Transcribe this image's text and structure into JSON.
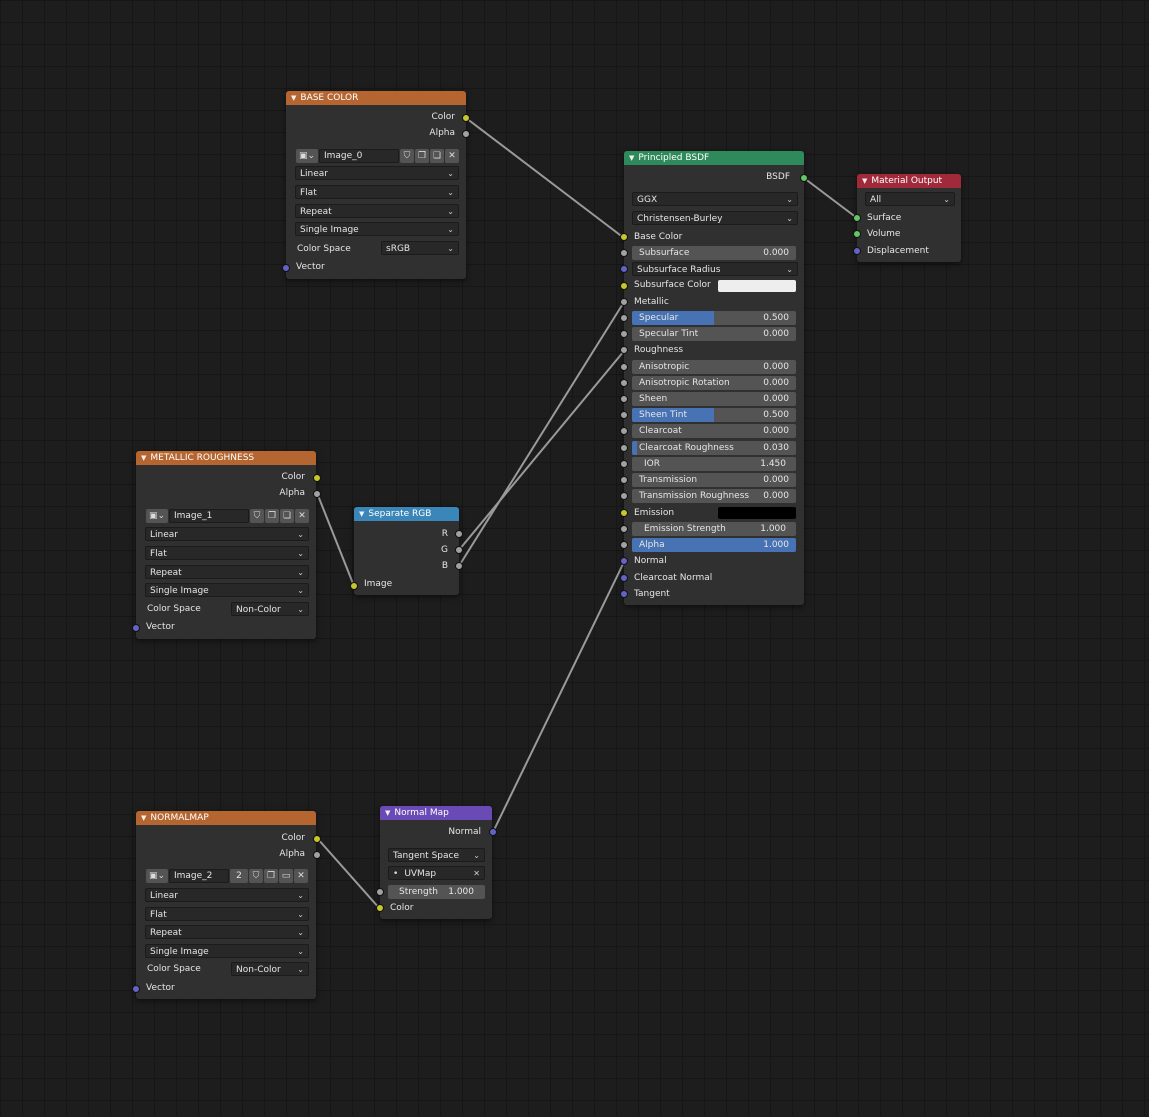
{
  "nodes": {
    "base_color": {
      "title": "BASE COLOR",
      "outputs": [
        "Color",
        "Alpha"
      ],
      "image_name": "Image_0",
      "interpolation": "Linear",
      "projection": "Flat",
      "extension": "Repeat",
      "source": "Single Image",
      "color_space_label": "Color Space",
      "color_space": "sRGB",
      "vector": "Vector"
    },
    "metallic_roughness": {
      "title": "METALLIC ROUGHNESS",
      "outputs": [
        "Color",
        "Alpha"
      ],
      "image_name": "Image_1",
      "interpolation": "Linear",
      "projection": "Flat",
      "extension": "Repeat",
      "source": "Single Image",
      "color_space_label": "Color Space",
      "color_space": "Non-Color",
      "vector": "Vector"
    },
    "normalmap": {
      "title": "NORMALMAP",
      "outputs": [
        "Color",
        "Alpha"
      ],
      "image_name": "Image_2",
      "user_count": "2",
      "interpolation": "Linear",
      "projection": "Flat",
      "extension": "Repeat",
      "source": "Single Image",
      "color_space_label": "Color Space",
      "color_space": "Non-Color",
      "vector": "Vector"
    },
    "separate_rgb": {
      "title": "Separate RGB",
      "outputs": [
        "R",
        "G",
        "B"
      ],
      "input": "Image"
    },
    "normal_map": {
      "title": "Normal Map",
      "output": "Normal",
      "space": "Tangent Space",
      "uv_map": "UVMap",
      "strength_label": "Strength",
      "strength_value": "1.000",
      "input": "Color"
    },
    "principled": {
      "title": "Principled BSDF",
      "output": "BSDF",
      "distribution": "GGX",
      "subsurface_method": "Christensen-Burley",
      "base_color": "Base Color",
      "subsurface": {
        "label": "Subsurface",
        "value": "0.000",
        "fill": 0
      },
      "subsurface_radius": "Subsurface Radius",
      "subsurface_color": "Subsurface Color",
      "metallic": "Metallic",
      "specular": {
        "label": "Specular",
        "value": "0.500",
        "fill": 0.5
      },
      "specular_tint": {
        "label": "Specular Tint",
        "value": "0.000",
        "fill": 0
      },
      "roughness": "Roughness",
      "anisotropic": {
        "label": "Anisotropic",
        "value": "0.000",
        "fill": 0
      },
      "anisotropic_rotation": {
        "label": "Anisotropic Rotation",
        "value": "0.000",
        "fill": 0
      },
      "sheen": {
        "label": "Sheen",
        "value": "0.000",
        "fill": 0
      },
      "sheen_tint": {
        "label": "Sheen Tint",
        "value": "0.500",
        "fill": 0.5
      },
      "clearcoat": {
        "label": "Clearcoat",
        "value": "0.000",
        "fill": 0
      },
      "clearcoat_roughness": {
        "label": "Clearcoat Roughness",
        "value": "0.030",
        "fill": 0.03
      },
      "ior": {
        "label": "IOR",
        "value": "1.450"
      },
      "transmission": {
        "label": "Transmission",
        "value": "0.000",
        "fill": 0
      },
      "transmission_roughness": {
        "label": "Transmission Roughness",
        "value": "0.000",
        "fill": 0
      },
      "emission": "Emission",
      "emission_strength": {
        "label": "Emission Strength",
        "value": "1.000"
      },
      "alpha": {
        "label": "Alpha",
        "value": "1.000",
        "fill": 1
      },
      "normal": "Normal",
      "clearcoat_normal": "Clearcoat Normal",
      "tangent": "Tangent"
    },
    "material_output": {
      "title": "Material Output",
      "target": "All",
      "inputs": [
        "Surface",
        "Volume",
        "Displacement"
      ]
    }
  },
  "colors": {
    "texture_header": "#b5652f",
    "converter_header": "#3a86b8",
    "vector_header": "#6a4bb5",
    "shader_header": "#2e8a5a",
    "output_header": "#a12a3a",
    "link": "#9a9a9a",
    "accent": "#4772b3",
    "subsurface_color": "#eeeeee",
    "emission_color": "#000000"
  }
}
